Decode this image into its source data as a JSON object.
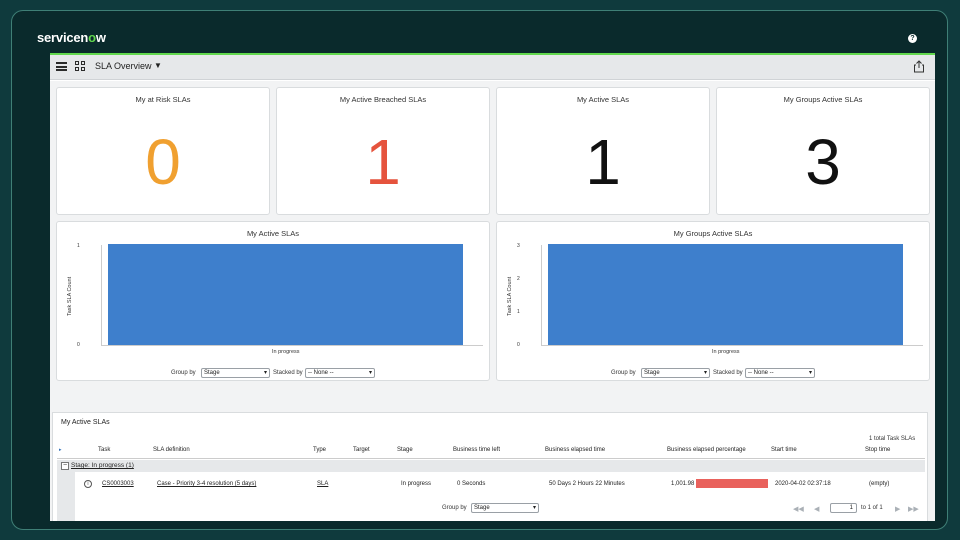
{
  "app": {
    "brand_prefix": "servicen",
    "brand_o": "o",
    "brand_suffix": "w",
    "help_icon": "question-icon"
  },
  "toolbar": {
    "title": "SLA Overview",
    "caret": "▼",
    "menu_icon": "hamburger-icon",
    "grid_icon": "grid-icon",
    "share_icon": "share-icon"
  },
  "scorecards": [
    {
      "title": "My at Risk SLAs",
      "value": "0",
      "color": "#f0a030"
    },
    {
      "title": "My Active Breached SLAs",
      "value": "1",
      "color": "#e5533d"
    },
    {
      "title": "My Active SLAs",
      "value": "1",
      "color": "#111111"
    },
    {
      "title": "My Groups Active SLAs",
      "value": "3",
      "color": "#111111"
    }
  ],
  "charts": {
    "left": {
      "title": "My Active SLAs",
      "ylabel": "Task SLA Count",
      "ymin": "0",
      "ymax": "1",
      "category": "In progress",
      "group_label": "Group by",
      "group_value": "Stage",
      "stack_label": "Stacked by",
      "stack_value": "-- None --"
    },
    "right": {
      "title": "My Groups Active SLAs",
      "ylabel": "Task SLA Count",
      "ymin": "0",
      "ymax": "3",
      "category": "In progress",
      "group_label": "Group by",
      "group_value": "Stage",
      "stack_label": "Stacked by",
      "stack_value": "-- None --",
      "ticks": [
        "3",
        "2",
        "1",
        "0"
      ]
    }
  },
  "chart_data": [
    {
      "type": "bar",
      "title": "My Active SLAs",
      "ylabel": "Task SLA Count",
      "categories": [
        "In progress"
      ],
      "values": [
        1
      ],
      "ylim": [
        0,
        1
      ]
    },
    {
      "type": "bar",
      "title": "My Groups Active SLAs",
      "ylabel": "Task SLA Count",
      "categories": [
        "In progress"
      ],
      "values": [
        3
      ],
      "ylim": [
        0,
        3
      ]
    }
  ],
  "list": {
    "title": "My Active SLAs",
    "total": "1  total Task SLAs",
    "columns": [
      "Task",
      "SLA definition",
      "Type",
      "Target",
      "Stage",
      "Business time left",
      "Business elapsed time",
      "Business elapsed percentage",
      "Start time",
      "Stop time"
    ],
    "group_label": "Stage: In progress (1)",
    "row": {
      "task": "CS0003003",
      "sla_definition": "Case - Priority 3-4 resolution (5 days)",
      "type": "SLA",
      "target": "",
      "stage": "In progress",
      "business_time_left": "0 Seconds",
      "business_elapsed_time": "50 Days 2 Hours 22 Minutes",
      "business_elapsed_percentage": "1,001.98",
      "start_time": "2020-04-02 02:37:18",
      "stop_time": "(empty)"
    },
    "group_by_label": "Group by",
    "group_by_value": "Stage",
    "pager": {
      "first": "◀◀",
      "prev": "◀",
      "page": "1",
      "of_text": "to 1 of 1",
      "next": "▶",
      "last": "▶▶"
    }
  }
}
